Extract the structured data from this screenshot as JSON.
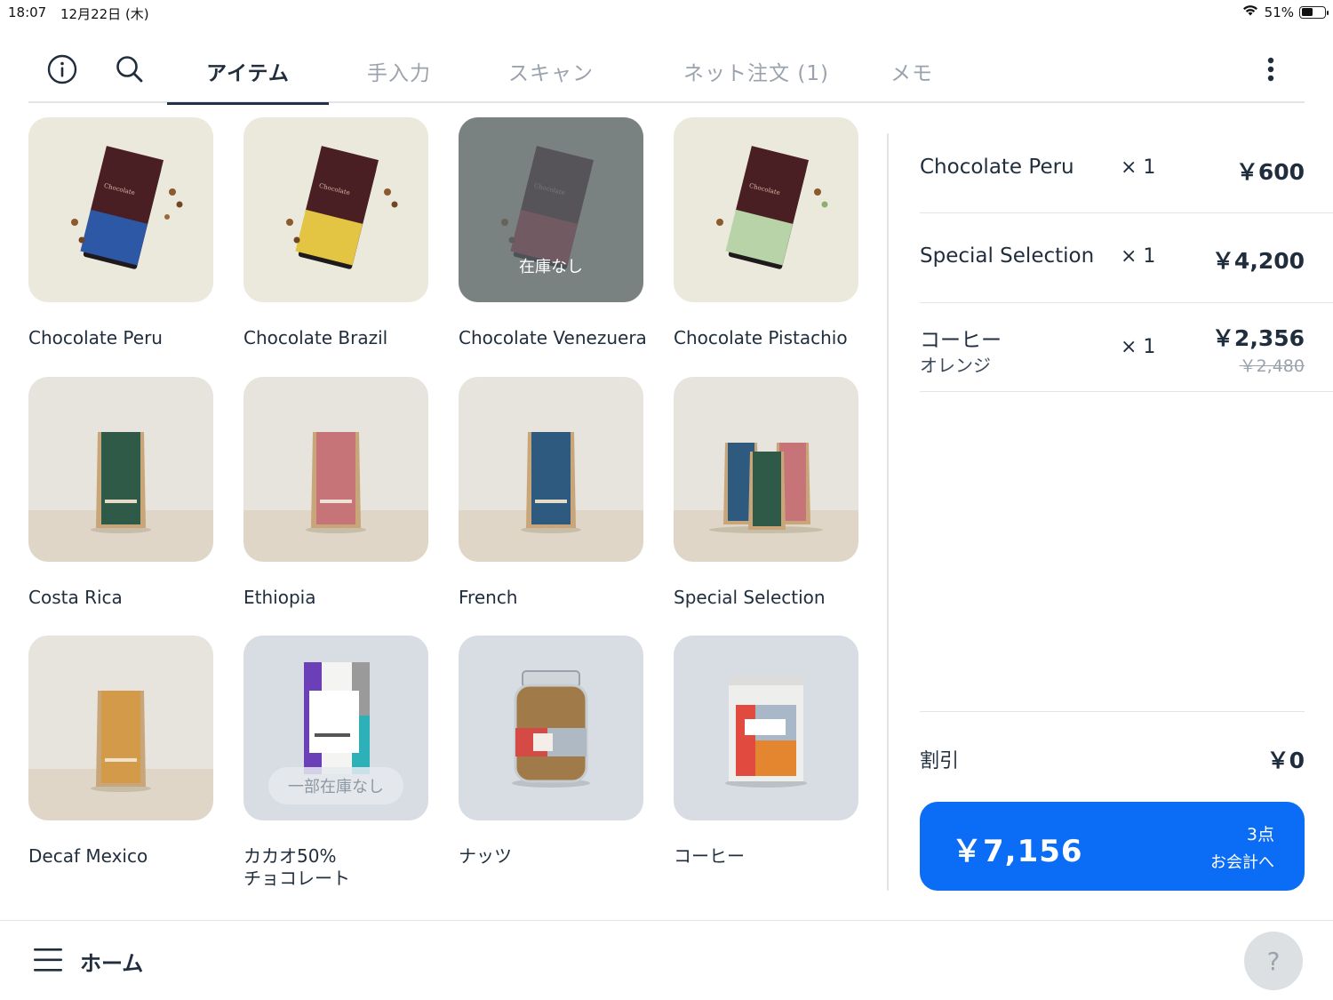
{
  "status_bar": {
    "time": "18:07",
    "date": "12月22日 (木)",
    "battery": "51%",
    "battery_level": 0.51
  },
  "toolbar": {
    "icons": [
      "info-icon",
      "search-icon",
      "more-vertical-icon"
    ],
    "tabs": [
      {
        "label": "アイテム",
        "active": true
      },
      {
        "label": "手入力",
        "active": false
      },
      {
        "label": "スキャン",
        "active": false
      },
      {
        "label": "ネット注文 (1)",
        "active": false
      },
      {
        "label": "メモ",
        "active": false
      }
    ]
  },
  "products": [
    {
      "name": "Chocolate Peru",
      "image": "chocolate-bar-blue",
      "status": ""
    },
    {
      "name": "Chocolate Brazil",
      "image": "chocolate-bar-yellow",
      "status": ""
    },
    {
      "name": "Chocolate Venezuera",
      "image": "chocolate-bar-red",
      "status": "在庫なし"
    },
    {
      "name": "Chocolate Pistachio",
      "image": "chocolate-bar-green",
      "status": ""
    },
    {
      "name": "Costa Rica",
      "image": "coffee-bag-green",
      "status": ""
    },
    {
      "name": "Ethiopia",
      "image": "coffee-bag-pink",
      "status": ""
    },
    {
      "name": "French",
      "image": "coffee-bag-blue",
      "status": ""
    },
    {
      "name": "Special Selection",
      "image": "coffee-bags-set",
      "status": ""
    },
    {
      "name": "Decaf Mexico",
      "image": "coffee-bag-orange",
      "status": ""
    },
    {
      "name": "カカオ50%",
      "name_line2": "チョコレート",
      "image": "cacao-bar-package",
      "status": "一部在庫なし"
    },
    {
      "name": "ナッツ",
      "image": "nut-jar",
      "status": ""
    },
    {
      "name": "コーヒー",
      "image": "coffee-pouch",
      "status": ""
    }
  ],
  "cart": {
    "items": [
      {
        "name": "Chocolate Peru",
        "variant": "",
        "qty": "× 1",
        "price": "￥600",
        "original_price": ""
      },
      {
        "name": "Special Selection",
        "variant": "",
        "qty": "× 1",
        "price": "￥4,200",
        "original_price": ""
      },
      {
        "name": "コーヒー",
        "variant": "オレンジ",
        "qty": "× 1",
        "price": "￥2,356",
        "original_price": "￥2,480"
      }
    ],
    "discount_label": "割引",
    "discount_value": "￥0",
    "checkout": {
      "total": "￥7,156",
      "count": "3点",
      "label": "お会計へ"
    }
  },
  "bottom_bar": {
    "home_label": "ホーム",
    "help_label": "?"
  },
  "colors": {
    "accent": "#0b6cf5",
    "text": "#1f2d3d",
    "muted": "#9aa3ad"
  }
}
